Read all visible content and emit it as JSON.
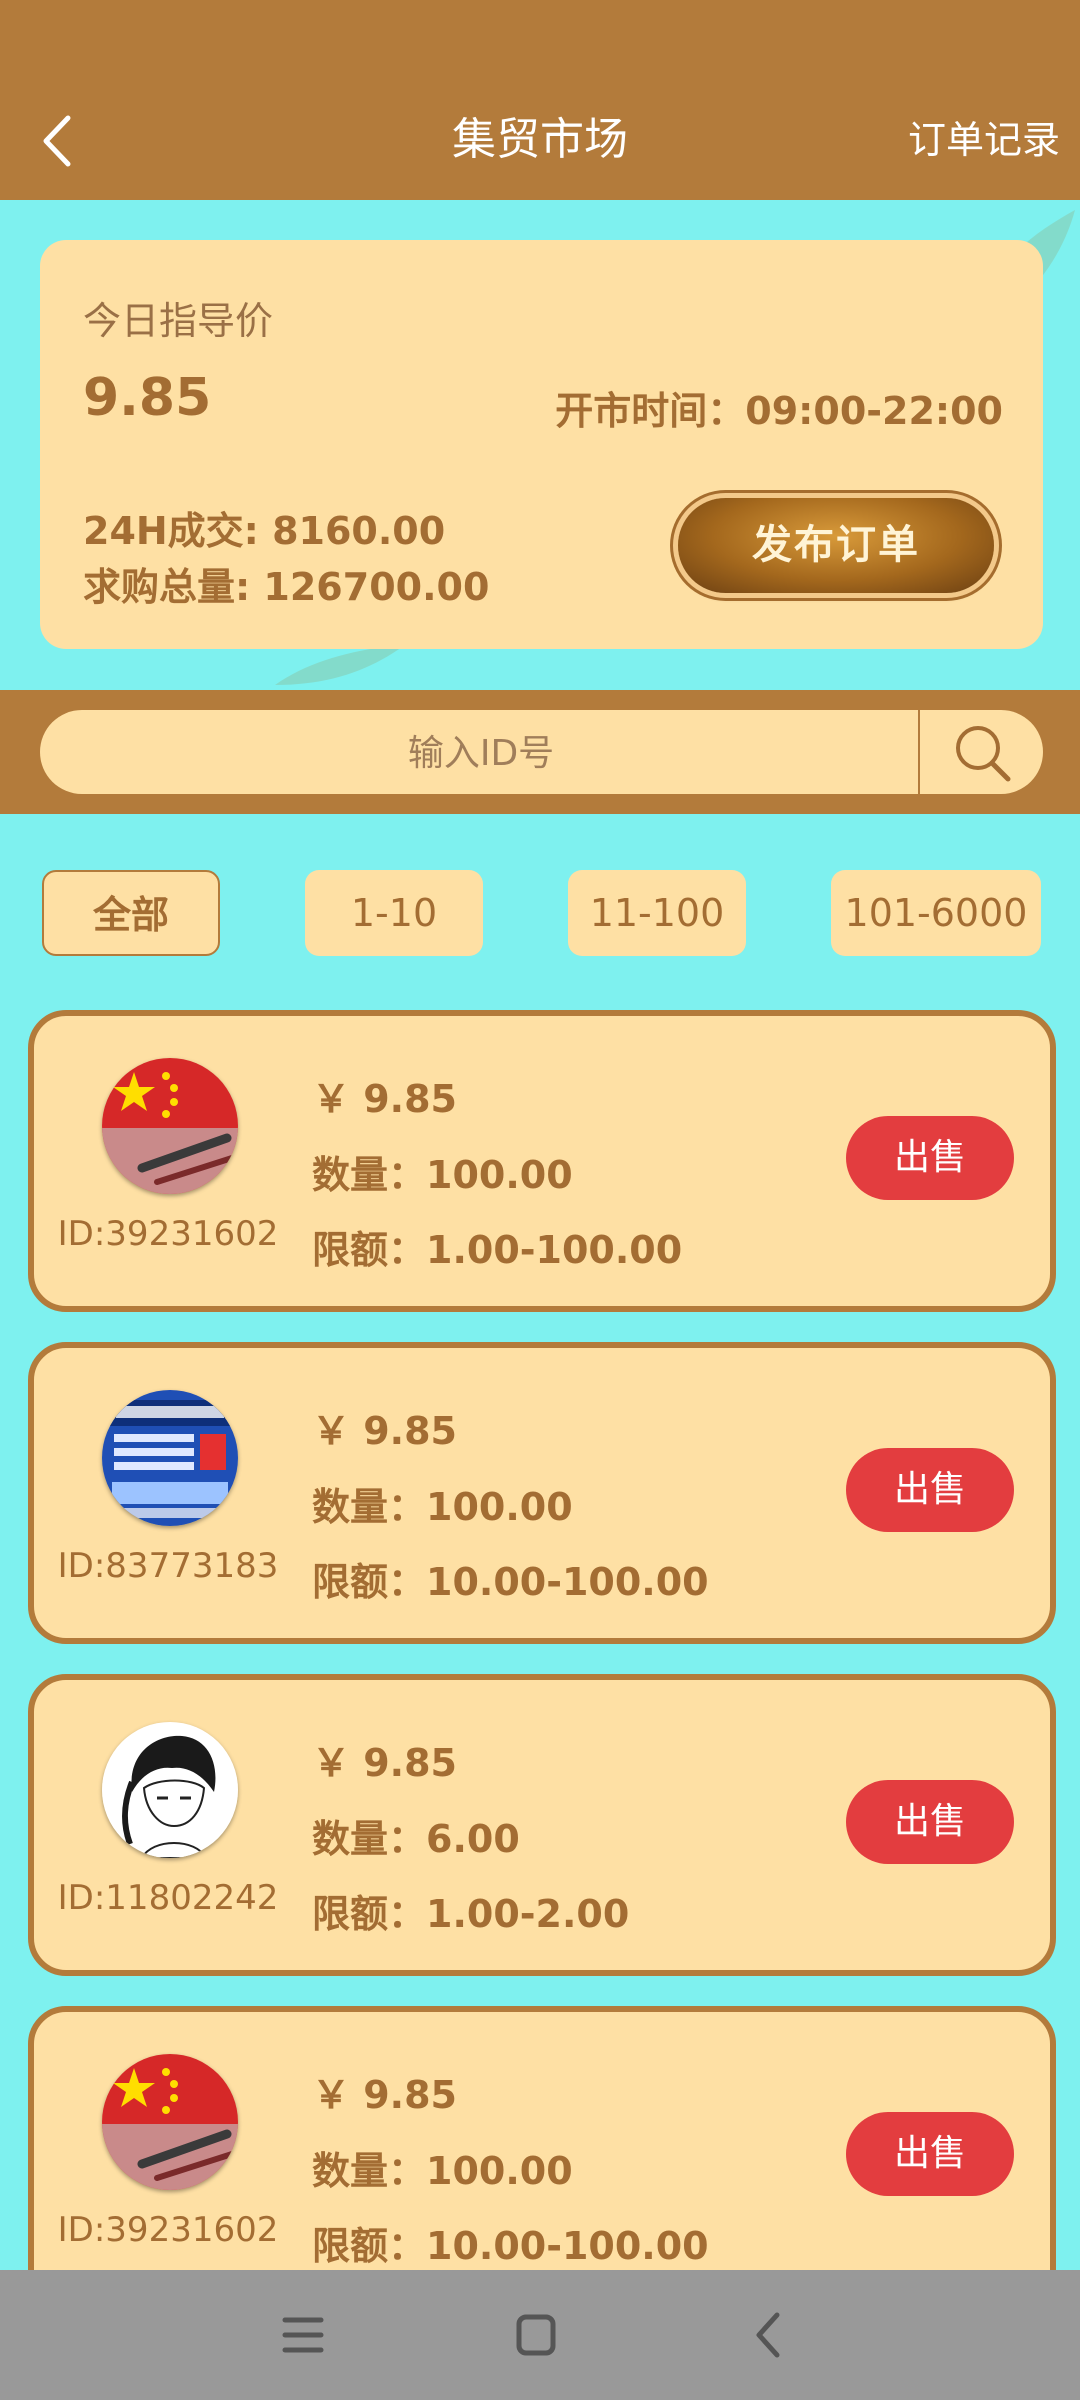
{
  "header": {
    "title": "集贸市场",
    "records_label": "订单记录"
  },
  "summary": {
    "guide_price_label": "今日指导价",
    "guide_price": "9.85",
    "hours_text": "开市时间：09:00-22:00",
    "volume_text": "24H成交: 8160.00",
    "demand_text": "求购总量: 126700.00",
    "publish_label": "发布订单"
  },
  "search": {
    "placeholder": "输入ID号"
  },
  "filters": [
    "全部",
    "1-10",
    "11-100",
    "101-6000"
  ],
  "orders": [
    {
      "avatar": "china-flag",
      "id": "ID:39231602",
      "price": "￥ 9.85",
      "qty": "数量：100.00",
      "limit": "限额：1.00-100.00",
      "action": "出售"
    },
    {
      "avatar": "blue-poster",
      "id": "ID:83773183",
      "price": "￥ 9.85",
      "qty": "数量：100.00",
      "limit": "限额：10.00-100.00",
      "action": "出售"
    },
    {
      "avatar": "manga-boy",
      "id": "ID:11802242",
      "price": "￥ 9.85",
      "qty": "数量：6.00",
      "limit": "限额：1.00-2.00",
      "action": "出售"
    },
    {
      "avatar": "china-flag",
      "id": "ID:39231602",
      "price": "￥ 9.85",
      "qty": "数量：100.00",
      "limit": "限额：10.00-100.00",
      "action": "出售"
    }
  ],
  "colors": {
    "header_bg": "#b37b3b",
    "page_bg": "#7ef1ef",
    "card_bg": "#fee0a4",
    "text_brown": "#a36d33",
    "sell_red": "#e33d3f",
    "nav_bg": "#999999"
  },
  "icons": {
    "back": "chevron-left-icon",
    "search": "search-icon",
    "nav_menu": "menu-icon",
    "nav_home": "square-icon",
    "nav_back": "chevron-left-icon"
  }
}
